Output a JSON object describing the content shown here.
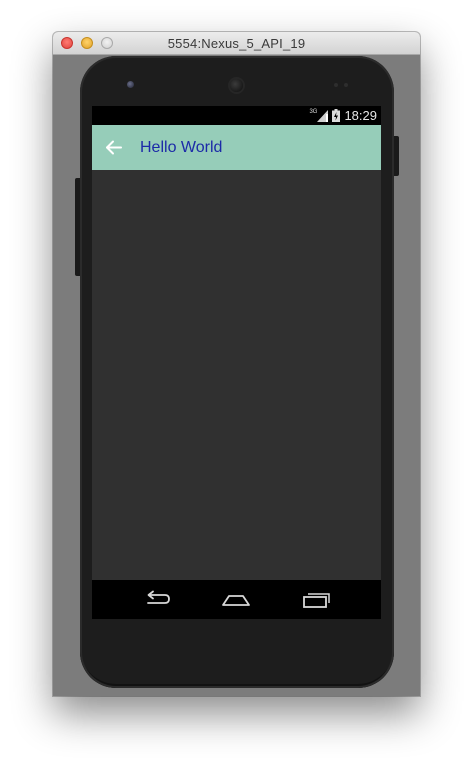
{
  "window": {
    "title": "5554:Nexus_5_API_19"
  },
  "statusbar": {
    "network": "3G",
    "time": "18:29"
  },
  "actionbar": {
    "title": "Hello World",
    "background": "#96cdb9",
    "title_color": "#1c2aa8",
    "nav_icon": "arrow-back-icon"
  },
  "navbar": {
    "icons": [
      "nav-back-icon",
      "nav-home-icon",
      "nav-recent-apps-icon"
    ]
  },
  "colors": {
    "screen_background": "#303030",
    "device_body": "#1d1d1d"
  }
}
